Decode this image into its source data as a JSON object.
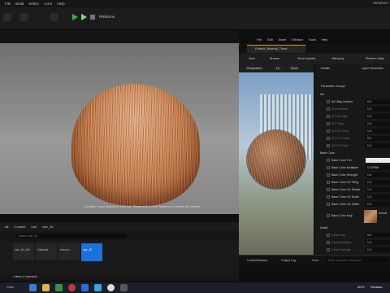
{
  "main": {
    "menu": [
      "File",
      "Build",
      "Select",
      "Actor",
      "Help"
    ],
    "window_title": "Metahum",
    "toolbar": {
      "platforms_label": "Platforms"
    },
    "viewport_message": "No active Level Sequencer detected. Please edit a Level Sequence to enable full controls."
  },
  "content_browser": {
    "path": [
      "All",
      "Content",
      "hair",
      "hair_45"
    ],
    "search_placeholder": "Search hair_45",
    "assets": [
      {
        "label": "hair_45_AIM",
        "selected": false
      },
      {
        "label": "Materials",
        "selected": false
      },
      {
        "label": "textures",
        "selected": false
      },
      {
        "label": "hair_45",
        "selected": true
      }
    ],
    "status": "4 items (1 selected)",
    "drawer_label": "Cmd"
  },
  "material_editor": {
    "menu": [
      "File",
      "Edit",
      "Asset",
      "Window",
      "Tools",
      "Help"
    ],
    "tab_title": "Default_Material_Trans...",
    "toolbar": [
      "Save",
      "Browse",
      "Show Inactive",
      "Hierarchy",
      "Platform Stats"
    ],
    "preview": {
      "mode_label": "Perspective",
      "lit_label": "Lit",
      "show_label": "Show"
    },
    "details": {
      "tab_label": "Details",
      "layer_tab_label": "Layer Parameter",
      "parameter_groups_label": "Parameter Groups",
      "ao_group": "AO",
      "ao_params": [
        {
          "name": "AO Map Instruct",
          "value": "0.0",
          "enabled": true
        },
        {
          "name": "AO Multiplier",
          "value": "1.0",
          "enabled": false
        },
        {
          "name": "AO Strength",
          "value": "1.0",
          "enabled": false
        },
        {
          "name": "AO Tiling",
          "value": "1.0",
          "enabled": false
        },
        {
          "name": "AO UV Tiling",
          "value": "1.0",
          "enabled": false
        },
        {
          "name": "AO UV Rotate",
          "value": "0.0",
          "enabled": false
        },
        {
          "name": "AO UV Scale",
          "value": "1.0",
          "enabled": false
        }
      ],
      "base_group": "Base Color",
      "base_params": [
        {
          "name": "Base Color Tint",
          "value": "",
          "enabled": true
        },
        {
          "name": "Base Color Multiplier",
          "value": "0.027868",
          "enabled": true
        },
        {
          "name": "Base Color Strength",
          "value": "1.0",
          "enabled": true
        },
        {
          "name": "Base Color UV Tiling",
          "value": "1.0",
          "enabled": true
        },
        {
          "name": "Base Color UV Rotate",
          "value": "1.0",
          "enabled": true
        },
        {
          "name": "Base Color UV Scale",
          "value": "1.0",
          "enabled": true
        },
        {
          "name": "Base Color UV Offset",
          "value": "1.0",
          "enabled": true
        },
        {
          "name": "Base Color Map",
          "value": "Default",
          "enabled": true
        }
      ],
      "detail_group": "Detail",
      "detail_params": [
        {
          "name": "Detail Map",
          "value": "0.0",
          "enabled": false
        },
        {
          "name": "Detail Multiplier",
          "value": "1.0",
          "enabled": false
        },
        {
          "name": "Detail Strength",
          "value": "1.0",
          "enabled": false
        }
      ]
    },
    "bottom": [
      "Content Drawer",
      "Output Log",
      "Cmd"
    ],
    "console_placeholder": "Enter Console Command"
  },
  "taskbar": {
    "temperature": "20°C",
    "weather": "Ventoso"
  },
  "colors": {
    "accent": "#1a73d9",
    "orange": "#d68a3a",
    "ue_green": "#39b54a"
  }
}
